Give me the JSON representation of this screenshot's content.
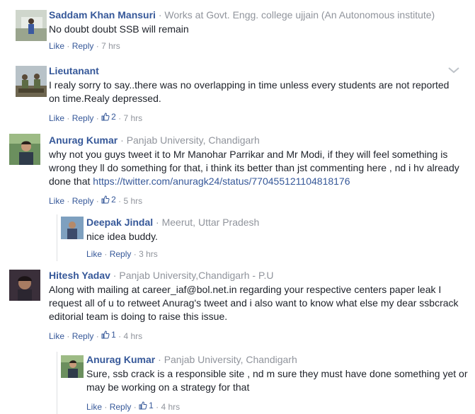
{
  "colors": {
    "link": "#365899",
    "meta": "#90949c",
    "text": "#1d2129"
  },
  "comments": [
    {
      "name": "Saddam Khan Mansuri",
      "work": "Works at Govt. Engg. college ujjain (An Autonomous institute)",
      "text": "No doubt doubt SSB will remain",
      "like": "Like",
      "reply": "Reply",
      "time": "7 hrs"
    },
    {
      "name": "Lieutanant",
      "text": "I realy sorry to say..there was no overlapping in time unless every students are not reported on time.Realy depressed.",
      "like": "Like",
      "reply": "Reply",
      "likes": "2",
      "time": "7 hrs"
    },
    {
      "name": "Anurag Kumar",
      "work": "Panjab University, Chandigarh",
      "text": "why not you guys tweet it to Mr Manohar Parrikar and Mr Modi, if they will feel something is wrong they ll do something for that, i think its better than jst commenting here , nd i hv already done that",
      "link": "https://twitter.com/anuragk24/status/770455121104818176",
      "like": "Like",
      "reply": "Reply",
      "likes": "2",
      "time": "5 hrs"
    },
    {
      "name": "Deepak Jindal",
      "work": "Meerut, Uttar Pradesh",
      "text": "nice idea buddy.",
      "like": "Like",
      "reply": "Reply",
      "time": "3 hrs"
    },
    {
      "name": "Hitesh Yadav",
      "work": "Panjab University,Chandigarh - P.U",
      "text": "Along with mailing at career_iaf@bol.net.in regarding your respective centers paper leak I request all of u to retweet Anurag's tweet and i also want to know what else my dear ssbcrack editorial team is doing to raise this issue.",
      "like": "Like",
      "reply": "Reply",
      "likes": "1",
      "time": "4 hrs"
    },
    {
      "name": "Anurag Kumar",
      "work": "Panjab University, Chandigarh",
      "text": "Sure, ssb crack is a responsible site , nd m sure they must have done something yet or may be working on a strategy for that",
      "like": "Like",
      "reply": "Reply",
      "likes": "1",
      "time": "4 hrs"
    }
  ]
}
